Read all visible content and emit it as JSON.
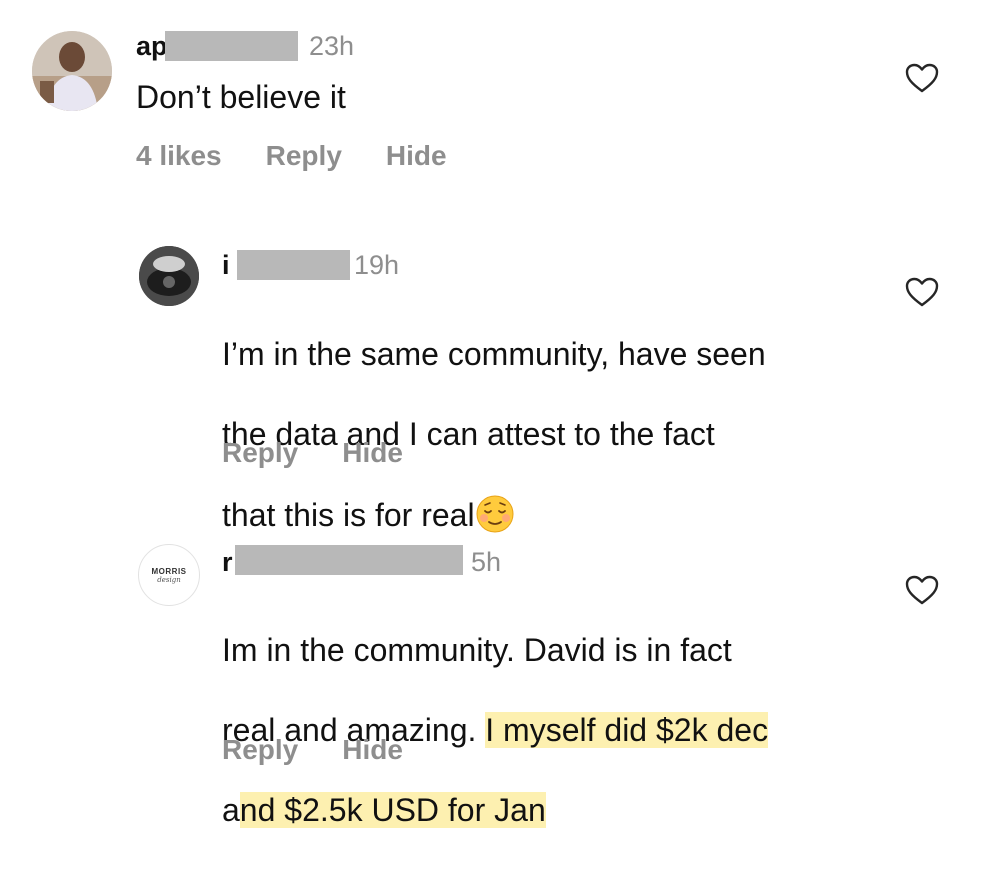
{
  "comments": [
    {
      "username_prefix": "ap",
      "time": "23h",
      "text": "Don’t believe it",
      "actions": [
        "4 likes",
        "Reply",
        "Hide"
      ]
    },
    {
      "username_prefix": "i",
      "time": "19h",
      "text_line1": "I’m in the same community, have seen",
      "text_line2": "the data and I can attest to the fact",
      "text_line3": "that this is for real",
      "emoji": "relieved-smiling-face-emoji",
      "actions": [
        "Reply",
        "Hide"
      ]
    },
    {
      "username_prefix": "r",
      "time": "5h",
      "avatar_text_line1": "MORRIS",
      "avatar_text_line2": "design",
      "text_line1": "Im in the community. David is in fact",
      "text_line2_plain": "real and amazing. ",
      "text_line2_highlight": "I myself did $2k dec",
      "text_line3_plain": "a",
      "text_line3_highlight": "nd $2.5k USD for Jan",
      "actions": [
        "Reply",
        "Hide"
      ]
    }
  ],
  "colors": {
    "text": "#111111",
    "muted": "#8e8e8e",
    "redaction": "#b8b8b8",
    "highlight": "#fdf0b0"
  },
  "icons": {
    "like": "heart-outline-icon"
  }
}
